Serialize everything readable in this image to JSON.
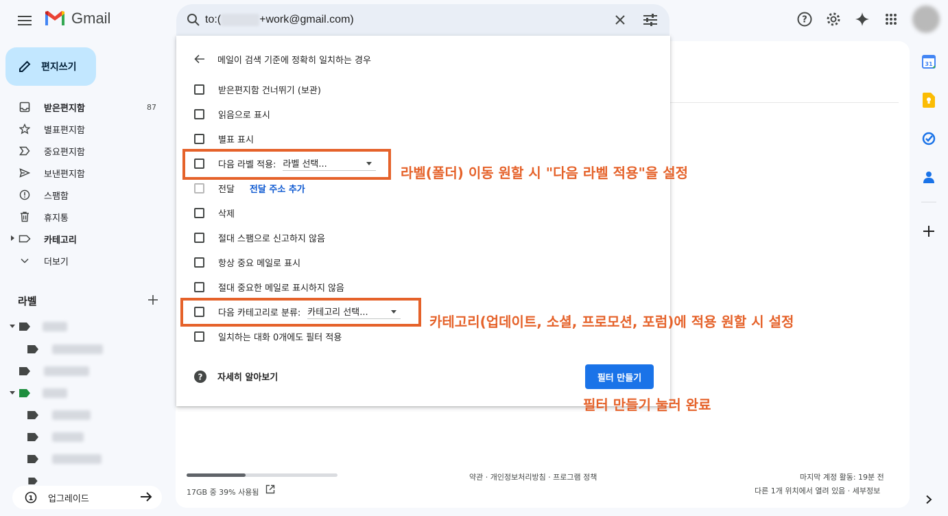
{
  "app": {
    "name": "Gmail"
  },
  "search": {
    "query_prefix": "to:(",
    "query_suffix": "+work@gmail.com)"
  },
  "compose": {
    "label": "편지쓰기"
  },
  "nav": [
    {
      "label": "받은편지함",
      "count": "87",
      "bold": true,
      "icon": "inbox-icon"
    },
    {
      "label": "별표편지함",
      "count": "",
      "bold": false,
      "icon": "star-icon"
    },
    {
      "label": "중요편지함",
      "count": "",
      "bold": false,
      "icon": "important-icon"
    },
    {
      "label": "보낸편지함",
      "count": "",
      "bold": false,
      "icon": "send-icon"
    },
    {
      "label": "스팸함",
      "count": "",
      "bold": false,
      "icon": "spam-icon"
    },
    {
      "label": "휴지통",
      "count": "",
      "bold": false,
      "icon": "trash-icon"
    },
    {
      "label": "카테고리",
      "count": "",
      "bold": true,
      "icon": "label-icon"
    },
    {
      "label": "더보기",
      "count": "",
      "bold": false,
      "icon": "chevron-down-icon"
    }
  ],
  "labels": {
    "title": "라벨"
  },
  "upgrade": {
    "label": "업그레이드"
  },
  "dialog": {
    "header": "메일이 검색 기준에 정확히 일치하는 경우",
    "options": [
      {
        "label": "받은편지함 건너뛰기 (보관)"
      },
      {
        "label": "읽음으로 표시"
      },
      {
        "label": "별표 표시"
      },
      {
        "label": "다음 라벨 적용:",
        "select": "라벨 선택..."
      },
      {
        "label": "전달",
        "link": "전달 주소 추가",
        "disabled": true
      },
      {
        "label": "삭제"
      },
      {
        "label": "절대 스팸으로 신고하지 않음"
      },
      {
        "label": "항상 중요 메일로 표시"
      },
      {
        "label": "절대 중요한 메일로 표시하지 않음"
      },
      {
        "label": "다음 카테고리로 분류:",
        "select": "카테고리 선택..."
      },
      {
        "label": "일치하는 대화 0개에도 필터 적용"
      }
    ],
    "help": "자세히 알아보기",
    "create_button": "필터 만들기"
  },
  "footer": {
    "storage": "17GB 중 39% 사용됨",
    "storage_used_fraction": 0.39,
    "links": "약관 · 개인정보처리방침 · 프로그램 정책",
    "last_activity": "마지막 계정 활동: 19분 전",
    "other_sessions": "다른 1개 위치에서 열려 있음 · 세부정보"
  },
  "annotations": {
    "label_note": "라벨(폴더) 이동 원할 시 \"다음 라벨 적용\"을 설정",
    "category_note": "카테고리(업데이트, 소셜, 프로모션, 포럼)에 적용 원할 시 설정",
    "create_note": "필터 만들기 눌러 완료",
    "color": "#e5622a"
  },
  "colors": {
    "compose_bg": "#c2e7ff",
    "primary_button": "#1a73e8",
    "link": "#0b57d0"
  }
}
